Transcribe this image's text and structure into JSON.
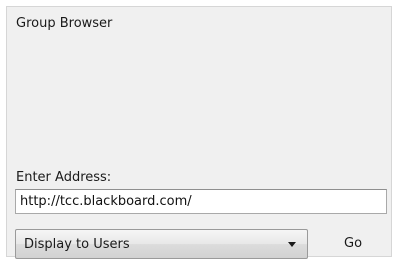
{
  "panel": {
    "title": "Group Browser"
  },
  "address": {
    "label": "Enter Address:",
    "value": "http://tcc.blackboard.com/"
  },
  "display": {
    "selected": "Display to Users"
  },
  "actions": {
    "go_label": "Go"
  }
}
